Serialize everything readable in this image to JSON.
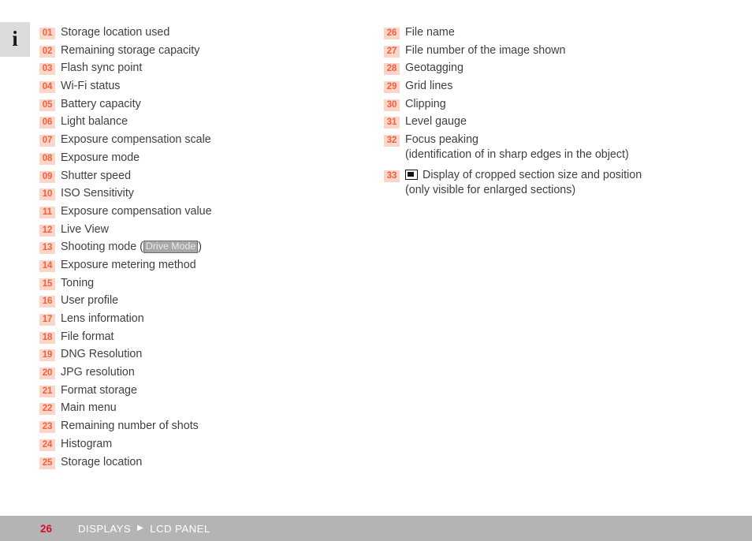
{
  "info_icon": {
    "name": "info-icon",
    "glyph": "i"
  },
  "left_column": {
    "items": [
      {
        "number": "01",
        "text": "Storage location used"
      },
      {
        "number": "02",
        "text": "Remaining storage capacity"
      },
      {
        "number": "03",
        "text": "Flash sync point"
      },
      {
        "number": "04",
        "text": "Wi-Fi status"
      },
      {
        "number": "05",
        "text": "Battery capacity"
      },
      {
        "number": "06",
        "text": "Light balance"
      },
      {
        "number": "07",
        "text": "Exposure compensation scale"
      },
      {
        "number": "08",
        "text": "Exposure mode"
      },
      {
        "number": "09",
        "text": "Shutter speed"
      },
      {
        "number": "10",
        "text": "ISO Sensitivity"
      },
      {
        "number": "11",
        "text": "Exposure compensation value"
      },
      {
        "number": "12",
        "text": "Live View"
      },
      {
        "number": "13",
        "text_before": "Shooting mode (",
        "token": "Drive Mode",
        "text_after": ")"
      },
      {
        "number": "14",
        "text": "Exposure metering method"
      },
      {
        "number": "15",
        "text": "Toning"
      },
      {
        "number": "16",
        "text": "User profile"
      },
      {
        "number": "17",
        "text": "Lens information"
      },
      {
        "number": "18",
        "text": "File format"
      },
      {
        "number": "19",
        "text": "DNG Resolution"
      },
      {
        "number": "20",
        "text": "JPG resolution"
      },
      {
        "number": "21",
        "text": "Format storage"
      },
      {
        "number": "22",
        "text": "Main menu"
      },
      {
        "number": "23",
        "text": "Remaining number of shots"
      },
      {
        "number": "24",
        "text": "Histogram"
      },
      {
        "number": "25",
        "text": "Storage location"
      }
    ]
  },
  "right_column": {
    "items": [
      {
        "number": "26",
        "text": "File name"
      },
      {
        "number": "27",
        "text": "File number of the image shown"
      },
      {
        "number": "28",
        "text": "Geotagging"
      },
      {
        "number": "29",
        "text": "Grid lines"
      },
      {
        "number": "30",
        "text": "Clipping"
      },
      {
        "number": "31",
        "text": "Level gauge"
      },
      {
        "number": "32",
        "text": "Focus peaking",
        "sub_text": "(identification of in sharp edges in the object)"
      },
      {
        "number": "33",
        "icon": "crop-section-icon",
        "text": "Display of cropped section size and position",
        "sub_text": "(only visible for enlarged sections)"
      }
    ]
  },
  "footer": {
    "page_number": "26",
    "crumb_section": "DISPLAYS",
    "crumb_arrow": "▶",
    "crumb_page": "LCD PANEL"
  },
  "colors": {
    "badge_background": "#fbd5c8",
    "badge_text": "#f2603f",
    "body_text": "#3f3f3f",
    "footer_background": "#b4b4b4",
    "footer_page_number": "#d4102b",
    "footer_text": "#ffffff",
    "info_icon_background": "#dcdcdc",
    "token_background": "#a8a8a8",
    "token_border": "#6e6e6e",
    "token_text": "#e9e9e9"
  }
}
